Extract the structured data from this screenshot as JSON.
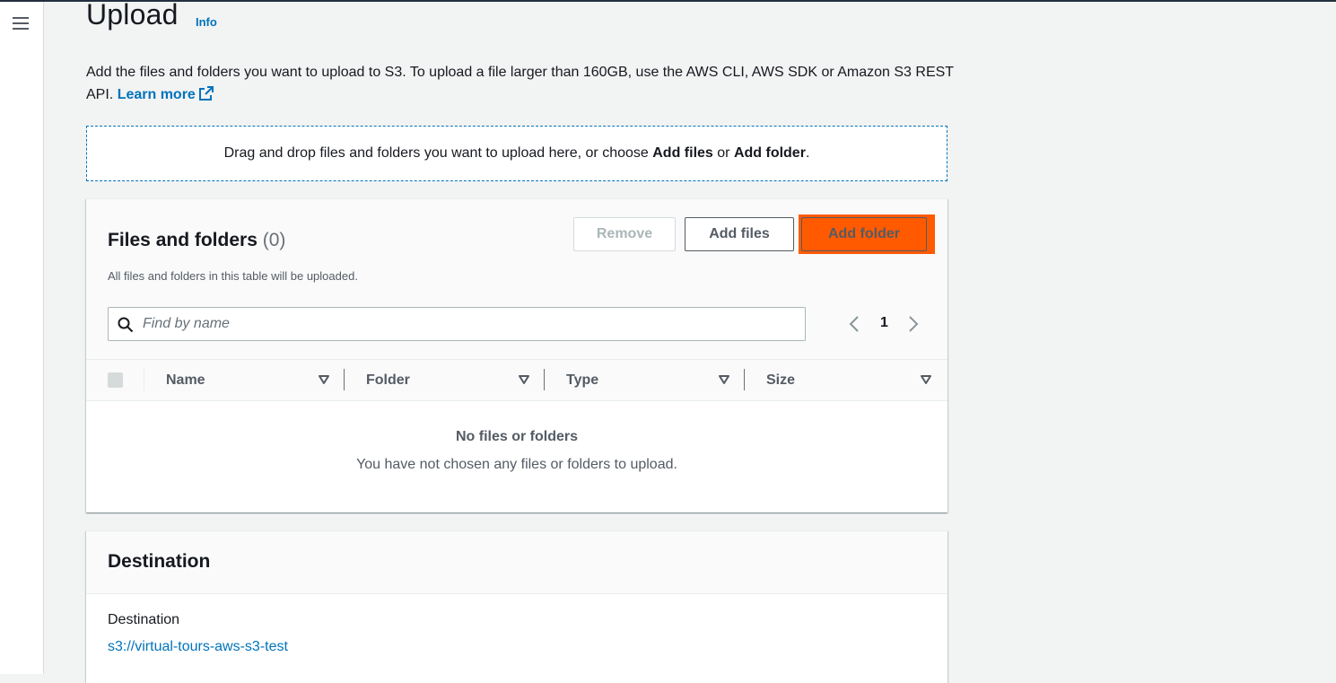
{
  "page": {
    "title": "Upload",
    "info_label": "Info",
    "intro_text": "Add the files and folders you want to upload to S3. To upload a file larger than 160GB, use the AWS CLI, AWS SDK or Amazon S3 REST API.",
    "learn_more_label": "Learn more"
  },
  "dropzone": {
    "text_prefix": "Drag and drop files and folders you want to upload here, or choose ",
    "add_files": "Add files",
    "or": " or ",
    "add_folder": "Add folder",
    "suffix": "."
  },
  "files_panel": {
    "title": "Files and folders",
    "count": "(0)",
    "description": "All files and folders in this table will be uploaded.",
    "buttons": {
      "remove": "Remove",
      "add_files": "Add files",
      "add_folder": "Add folder"
    },
    "search_placeholder": "Find by name",
    "pagination": {
      "current_page": "1"
    },
    "columns": [
      "Name",
      "Folder",
      "Type",
      "Size"
    ],
    "empty_title": "No files or folders",
    "empty_description": "You have not chosen any files or folders to upload."
  },
  "destination": {
    "title": "Destination",
    "label": "Destination",
    "value": "s3://virtual-tours-aws-s3-test"
  },
  "colors": {
    "accent_link": "#0073bb",
    "highlight": "#ff5a00",
    "border_disabled": "#d5dbdb"
  },
  "icons": [
    "hamburger-menu-icon",
    "external-link-icon",
    "search-icon",
    "chevron-left-icon",
    "chevron-right-icon",
    "sort-icon"
  ]
}
